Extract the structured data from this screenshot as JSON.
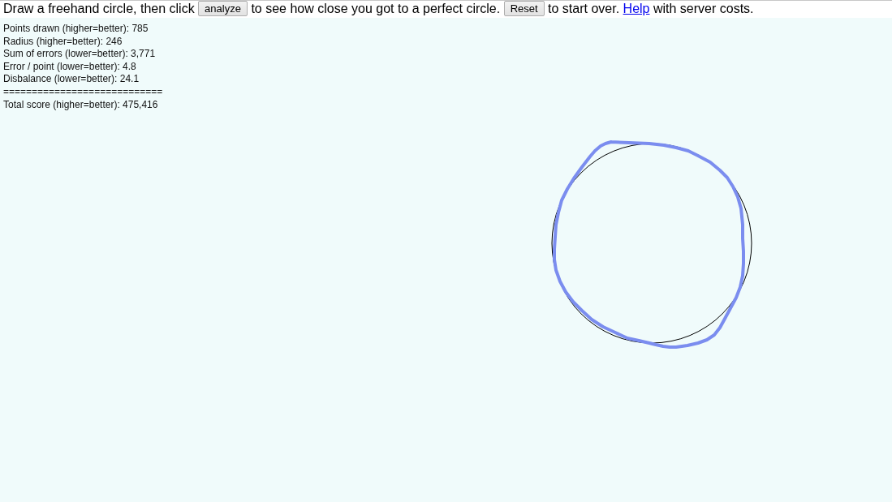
{
  "instructions": [
    {
      "kind": "text",
      "text": "Draw a freehand circle, then click"
    },
    {
      "kind": "button",
      "label": "analyze"
    },
    {
      "kind": "text",
      "text": "to see how close you got to a perfect circle."
    },
    {
      "kind": "button",
      "label": "Reset"
    },
    {
      "kind": "text",
      "text": "to start over."
    },
    {
      "kind": "link",
      "label": "Help"
    },
    {
      "kind": "text",
      "text": "with server costs."
    }
  ],
  "results": {
    "lines": [
      "Points drawn (higher=better): 785",
      "Radius (higher=better): 246",
      "Sum of errors (lower=better): 3,771",
      "Error / point (lower=better): 4.8",
      "Disbalance (lower=better): 24.1"
    ],
    "separator": "============================",
    "total": "Total score (higher=better): 475,416"
  }
}
